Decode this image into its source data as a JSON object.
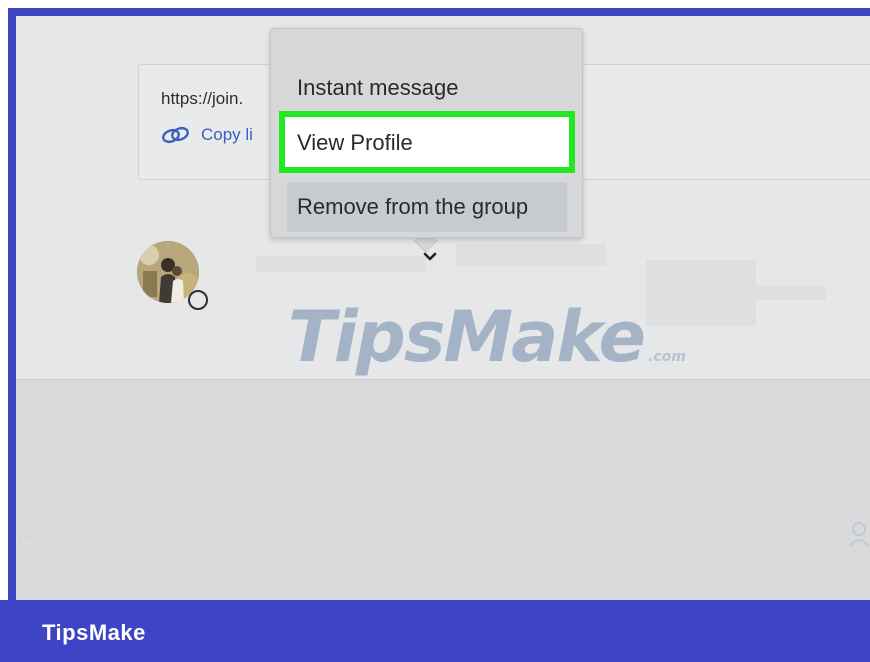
{
  "invite": {
    "url_text": "https://join.",
    "copy_link_label": "Copy li"
  },
  "context_menu": {
    "items": [
      {
        "label": "Instant message"
      },
      {
        "label": "View Profile"
      },
      {
        "label": "Remove from the group"
      }
    ]
  },
  "watermark": {
    "text": "TipsMake",
    "suffix": ".com"
  },
  "footer": {
    "brand": "TipsMake"
  },
  "colors": {
    "frame_border": "#3d45c4",
    "highlight_border": "#22e822",
    "link": "#3b62b8",
    "menu_background": "#d6d7d8"
  },
  "icons": {
    "copy_link": "link-chain-icon",
    "chevron": "chevron-down-icon",
    "presence": "status-ring-icon",
    "side": "person-add-icon"
  }
}
